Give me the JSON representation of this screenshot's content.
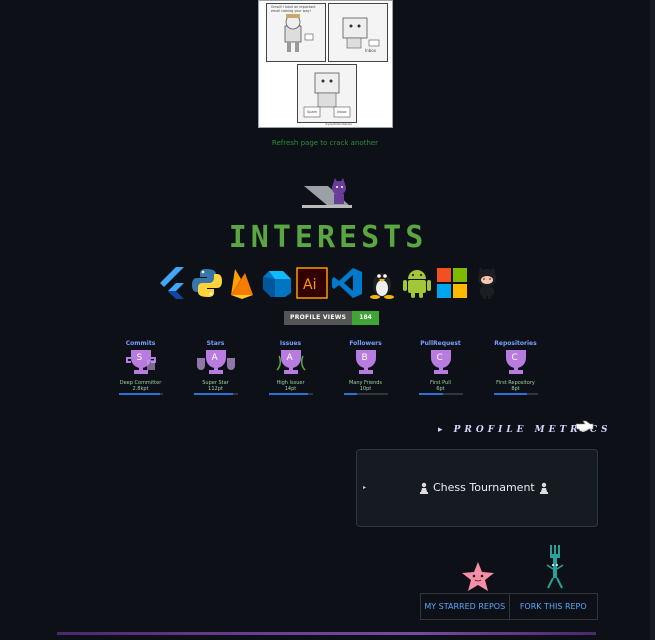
{
  "comic": {
    "speech": "Gmail! I have an important email coming your way!",
    "label_spam": "Spam",
    "label_inbox": "Inbox",
    "credit": "/sysadminsdiaries"
  },
  "refresh_text": "Refresh page to crack another",
  "interests_heading": "INTERESTS",
  "interest_icons": [
    {
      "name": "flutter-icon"
    },
    {
      "name": "python-icon"
    },
    {
      "name": "firebase-icon"
    },
    {
      "name": "dart-icon"
    },
    {
      "name": "illustrator-icon"
    },
    {
      "name": "vscode-icon"
    },
    {
      "name": "linux-icon"
    },
    {
      "name": "android-icon"
    },
    {
      "name": "microsoft-icon"
    },
    {
      "name": "github-icon"
    }
  ],
  "profile_views": {
    "label": "PROFILE VIEWS",
    "count": "184"
  },
  "trophies": [
    {
      "category": "Commits",
      "rank": "S",
      "title": "Deep Committer",
      "points": "2.8kpt",
      "progress": 0.95,
      "color": "#b87be0"
    },
    {
      "category": "Stars",
      "rank": "A",
      "title": "Super Star",
      "points": "112pt",
      "progress": 0.9,
      "color": "#b87be0"
    },
    {
      "category": "Issues",
      "rank": "A",
      "title": "High Issuer",
      "points": "14pt",
      "progress": 0.9,
      "color": "#b87be0"
    },
    {
      "category": "Followers",
      "rank": "B",
      "title": "Many Friends",
      "points": "10pt",
      "progress": 0.3,
      "color": "#b87be0"
    },
    {
      "category": "PullRequest",
      "rank": "C",
      "title": "First Pull",
      "points": "6pt",
      "progress": 0.55,
      "color": "#b87be0"
    },
    {
      "category": "Repositories",
      "rank": "C",
      "title": "First Repository",
      "points": "8pt",
      "progress": 0.75,
      "color": "#b87be0"
    }
  ],
  "metrics_heading": "PROFILE METRICS",
  "chess": {
    "toggle": "▸",
    "title": "Chess Tournament"
  },
  "repo_links": {
    "starred": "MY STARRED REPOS",
    "fork": "FORK THIS REPO"
  }
}
